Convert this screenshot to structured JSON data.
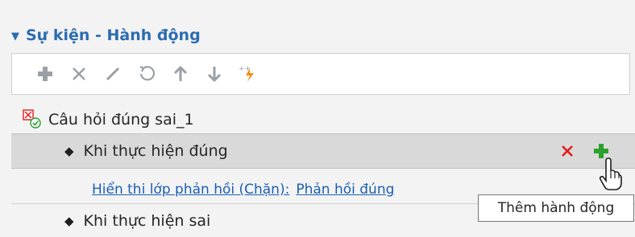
{
  "panel": {
    "title": "Sự kiện - Hành động"
  },
  "toolbar": {
    "buttons": [
      {
        "name": "add-icon"
      },
      {
        "name": "delete-icon"
      },
      {
        "name": "edit-icon"
      },
      {
        "name": "undo-icon"
      },
      {
        "name": "move-up-icon"
      },
      {
        "name": "move-down-icon"
      },
      {
        "name": "magic-action-icon"
      }
    ]
  },
  "tree": {
    "root_label": "Câu hỏi đúng sai_1",
    "trigger_correct": "Khi thực hiện đúng",
    "action_label": "Hiển thi lớp phản hồi (Chặn):",
    "action_value": "Phản hồi đúng",
    "trigger_incorrect": "Khi thực hiện sai"
  },
  "tooltip": {
    "text": "Thêm hành động"
  },
  "colors": {
    "accent": "#2b6cb0",
    "delete": "#e21b1b",
    "add": "#2ca02c",
    "magic": "#f28c1b"
  }
}
